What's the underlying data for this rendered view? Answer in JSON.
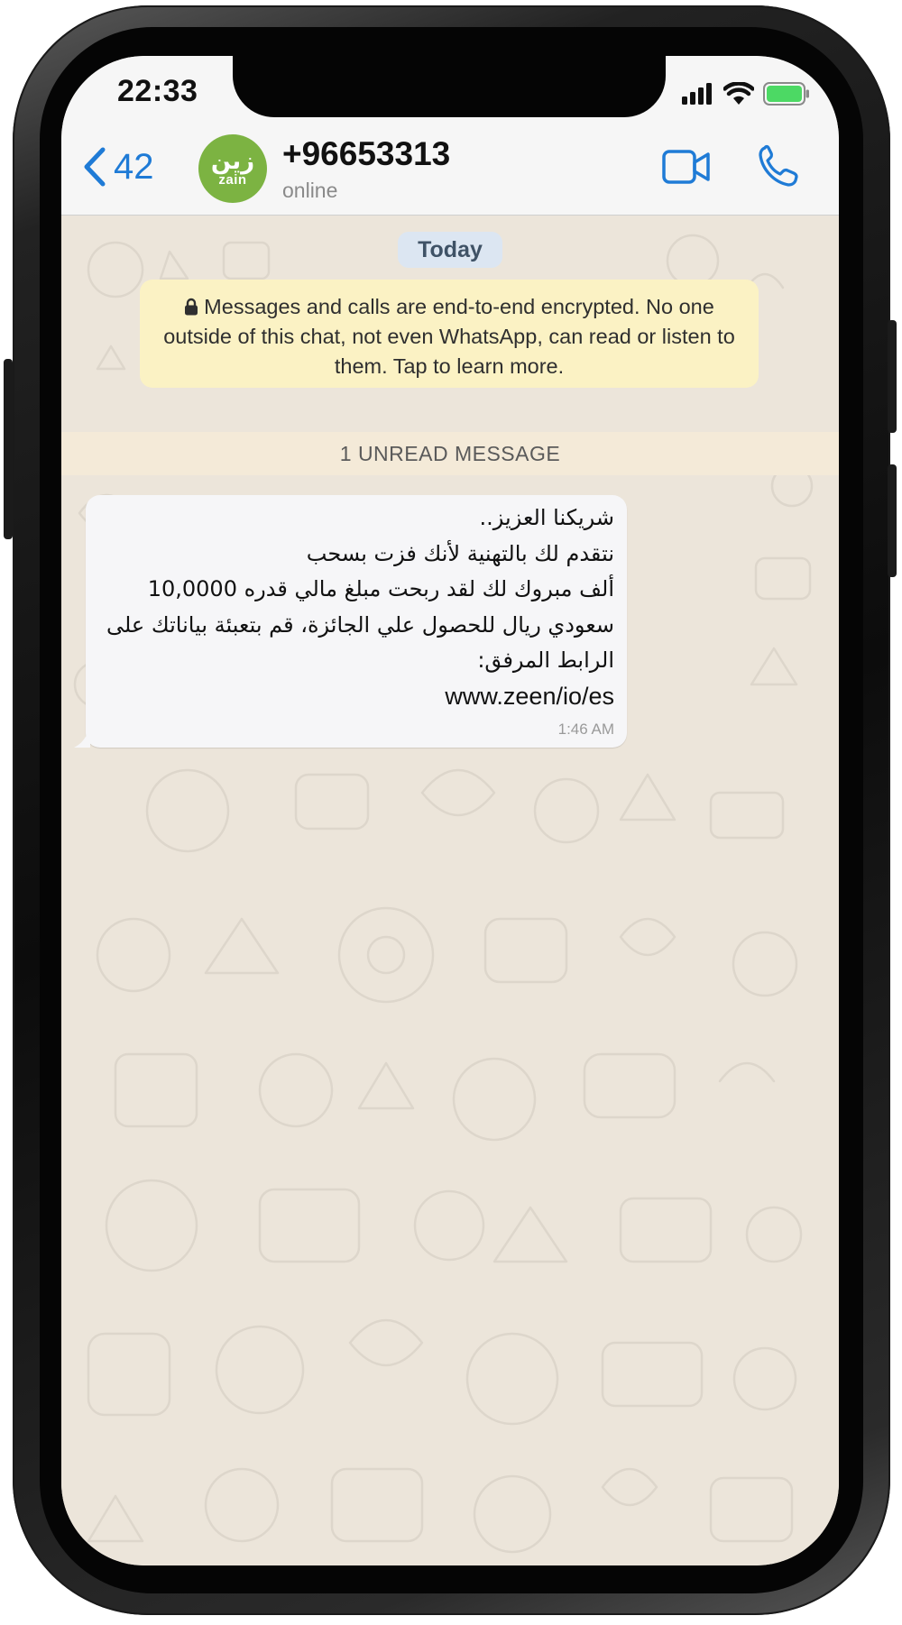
{
  "status_bar": {
    "time": "22:33"
  },
  "header": {
    "back_count": "42",
    "avatar": {
      "arabic": "زين",
      "latin": "zain"
    },
    "contact_name": "+96653313",
    "contact_status": "online",
    "icons": [
      "chevron-left-icon",
      "video-camera-icon",
      "phone-icon"
    ]
  },
  "chat": {
    "day_label": "Today",
    "encryption_notice": "Messages and calls are end-to-end encrypted. No one outside of this chat, not even WhatsApp, can read or listen to them. Tap to learn more.",
    "unread_label": "1 UNREAD MESSAGE",
    "message": {
      "lines": [
        "شريكنا العزيز..",
        "نتقدم لك بالتهنية لأنك فزت بسحب",
        "ألف مبروك لك لقد ربحت مبلغ مالي قدره 10,0000",
        "سعودي ريال للحصول علي الجائزة، قم بتعبئة بياناتك على",
        "الرابط المرفق:"
      ],
      "url": "www.zeen/io/es",
      "time": "1:46 AM"
    }
  },
  "colors": {
    "accent": "#1f7bd6",
    "avatar_bg": "#7cb342",
    "chat_bg": "#ece5da",
    "notice_bg": "#fbf2c4",
    "day_pill_bg": "#dce6f2"
  }
}
